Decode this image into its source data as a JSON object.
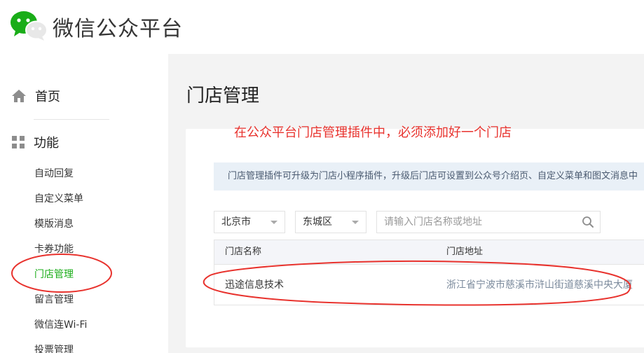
{
  "header": {
    "brand": "微信公众平台"
  },
  "sidebar": {
    "home_label": "首页",
    "section_label": "功能",
    "items": [
      {
        "label": "自动回复"
      },
      {
        "label": "自定义菜单"
      },
      {
        "label": "模版消息"
      },
      {
        "label": "卡券功能"
      },
      {
        "label": "门店管理",
        "active": true
      },
      {
        "label": "留言管理"
      },
      {
        "label": "微信连Wi-Fi"
      },
      {
        "label": "投票管理"
      }
    ]
  },
  "main": {
    "title": "门店管理",
    "annotation": "在公众平台门店管理插件中，必须添加好一个门店",
    "notice": "门店管理插件可升级为门店小程序插件，升级后门店可设置到公众号介绍页、自定义菜单和图文消息中",
    "filters": {
      "city": "北京市",
      "district": "东城区",
      "search_placeholder": "请输入门店名称或地址"
    },
    "table": {
      "headers": [
        "门店名称",
        "门店地址"
      ],
      "rows": [
        {
          "name": "迅途信息技术",
          "address": "浙江省宁波市慈溪市浒山街道慈溪中央大厦"
        }
      ]
    }
  },
  "colors": {
    "accent_green": "#1aad19",
    "annotation_red": "#e8322d",
    "notice_bg": "#e9f0f7",
    "address_text": "#7b8a9c"
  }
}
